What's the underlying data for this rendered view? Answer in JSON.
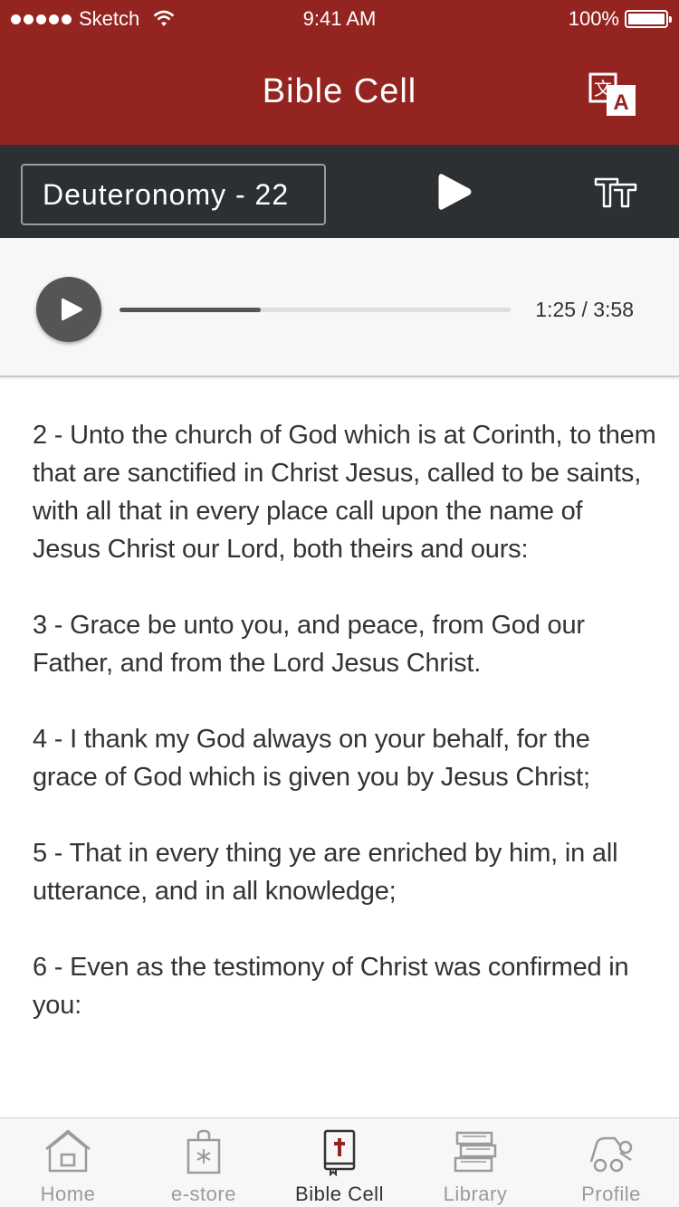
{
  "status_bar": {
    "carrier": "Sketch",
    "time": "9:41 AM",
    "battery": "100%"
  },
  "header": {
    "title": "Bible Cell",
    "translate_icon": "translate-icon"
  },
  "toolbar": {
    "chapter": "Deuteronomy - 22",
    "play_icon": "play-icon",
    "font_size_icon": "text-size-icon"
  },
  "player": {
    "progress": 0.36,
    "time": "1:25 / 3:58"
  },
  "verses": [
    "2 - Unto the church of God which is at Corinth, to them that are sanctified in Christ Jesus, called to be saints, with all that in every place call upon the name of Jesus Christ our Lord, both theirs and ours:",
    "3 - Grace be unto you, and peace, from God our Father, and from the Lord Jesus Christ.",
    "4 - I thank my God always on your behalf, for the grace of God which is given you by Jesus Christ;",
    "5 - That in every thing ye are enriched by him, in all utterance, and in all knowledge;",
    "6 - Even as the testimony of Christ was confirmed in you:"
  ],
  "tabs": [
    {
      "label": "Home",
      "icon": "home-icon",
      "active": false
    },
    {
      "label": "e-store",
      "icon": "shopping-bag-icon",
      "active": false
    },
    {
      "label": "Bible Cell",
      "icon": "bible-icon",
      "active": true
    },
    {
      "label": "Library",
      "icon": "books-icon",
      "active": false
    },
    {
      "label": "Profile",
      "icon": "profile-icon",
      "active": false
    }
  ],
  "colors": {
    "brand": "#942420",
    "toolbar": "#2d3032",
    "active_tab": "#333333",
    "inactive_tab": "#9b9b9b"
  }
}
